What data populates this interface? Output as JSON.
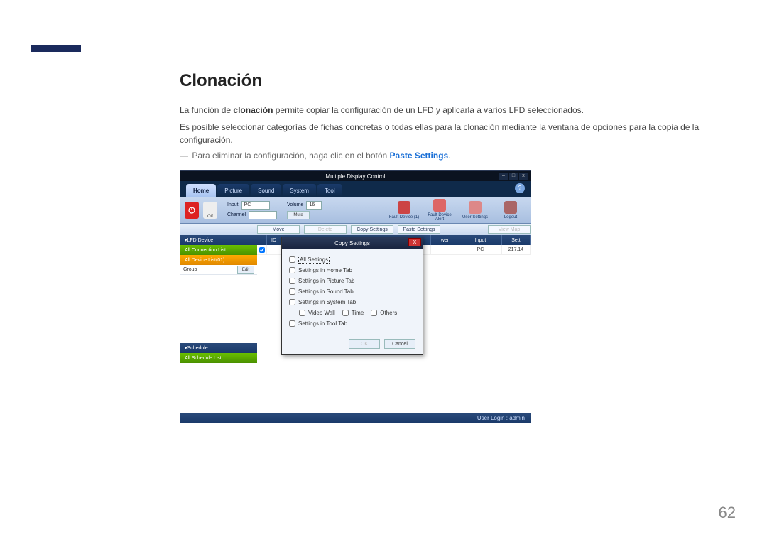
{
  "page": {
    "heading": "Clonación",
    "para1_pre": "La función de ",
    "para1_bold": "clonación",
    "para1_post": " permite copiar la configuración de un LFD y aplicarla a varios LFD seleccionados.",
    "para2": "Es posible seleccionar categorías de fichas concretas o todas ellas para la clonación mediante la ventana de opciones para la copia de la configuración.",
    "note_dash": "―",
    "note_pre": "Para eliminar la configuración, haga clic en el botón ",
    "note_hl": "Paste Settings",
    "note_post": ".",
    "page_number": "62"
  },
  "app": {
    "title": "Multiple Display Control",
    "window_buttons": {
      "min": "–",
      "max": "□",
      "close": "x"
    },
    "help_icon": "?",
    "tabs": [
      "Home",
      "Picture",
      "Sound",
      "System",
      "Tool"
    ],
    "toolbar": {
      "on_label": "On",
      "off_label": "Off",
      "input_label": "Input",
      "input_value": "PC",
      "channel_label": "Channel",
      "volume_label": "Volume",
      "volume_value": "16",
      "mute_btn": "Mute",
      "icons": [
        {
          "name": "fault-device-1-icon",
          "label": "Fault Device (1)",
          "color": "#c44"
        },
        {
          "name": "fault-device-alert-icon",
          "label": "Fault Device Alert",
          "color": "#d66"
        },
        {
          "name": "user-settings-icon",
          "label": "User Settings",
          "color": "#d88"
        },
        {
          "name": "logout-icon",
          "label": "Logout",
          "color": "#a66"
        }
      ]
    },
    "button_row": {
      "move": "Move",
      "delete": "Delete",
      "copy": "Copy Settings",
      "paste": "Paste Settings",
      "viewmap": "View Map"
    },
    "sidebar": {
      "lfd_header": "LFD Device",
      "all_connection": "All Connection List",
      "all_device": "All Device List(01)",
      "group_label": "Group",
      "edit_label": "Edit",
      "schedule_header": "Schedule",
      "all_schedule": "All Schedule List"
    },
    "grid": {
      "headers": [
        "",
        "ID",
        "",
        "",
        "wer",
        "Input",
        "Sett"
      ],
      "row1_input": "PC",
      "row1_sett": "217.14"
    },
    "statusbar": "User Login : admin"
  },
  "dialog": {
    "title": "Copy Settings",
    "close": "X",
    "options": [
      "All Settings",
      "Settings in Home Tab",
      "Settings in Picture Tab",
      "Settings in Sound Tab",
      "Settings in System Tab",
      "Settings in Tool Tab"
    ],
    "sub_options": [
      "Video Wall",
      "Time",
      "Others"
    ],
    "ok": "OK",
    "cancel": "Cancel"
  }
}
